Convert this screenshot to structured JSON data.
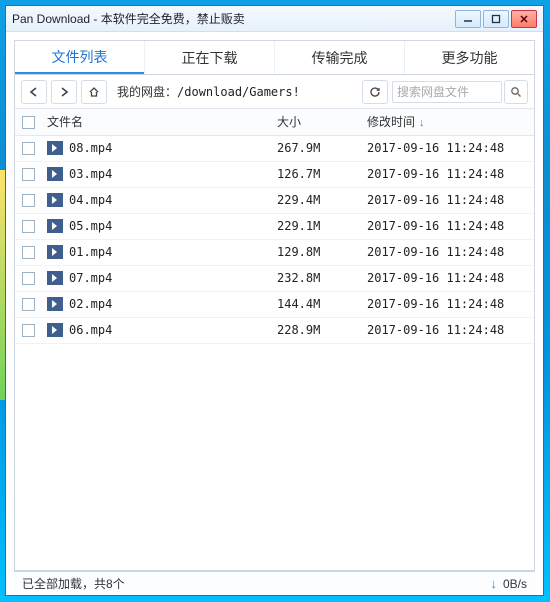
{
  "window": {
    "title": "Pan Download - 本软件完全免费，禁止贩卖"
  },
  "tabs": [
    {
      "label": "文件列表",
      "active": true
    },
    {
      "label": "正在下载",
      "active": false
    },
    {
      "label": "传输完成",
      "active": false
    },
    {
      "label": "更多功能",
      "active": false
    }
  ],
  "toolbar": {
    "path_prefix": "我的网盘：",
    "path_value": "/download/Gamers!",
    "search_placeholder": "搜索网盘文件"
  },
  "columns": {
    "name": "文件名",
    "size": "大小",
    "time": "修改时间",
    "sort_indicator": "↓"
  },
  "files": [
    {
      "name": "08.mp4",
      "size": "267.9M",
      "time": "2017-09-16 11:24:48"
    },
    {
      "name": "03.mp4",
      "size": "126.7M",
      "time": "2017-09-16 11:24:48"
    },
    {
      "name": "04.mp4",
      "size": "229.4M",
      "time": "2017-09-16 11:24:48"
    },
    {
      "name": "05.mp4",
      "size": "229.1M",
      "time": "2017-09-16 11:24:48"
    },
    {
      "name": "01.mp4",
      "size": "129.8M",
      "time": "2017-09-16 11:24:48"
    },
    {
      "name": "07.mp4",
      "size": "232.8M",
      "time": "2017-09-16 11:24:48"
    },
    {
      "name": "02.mp4",
      "size": "144.4M",
      "time": "2017-09-16 11:24:48"
    },
    {
      "name": "06.mp4",
      "size": "228.9M",
      "time": "2017-09-16 11:24:48"
    }
  ],
  "status": {
    "text": "已全部加载，共8个",
    "speed": "0B/s"
  }
}
